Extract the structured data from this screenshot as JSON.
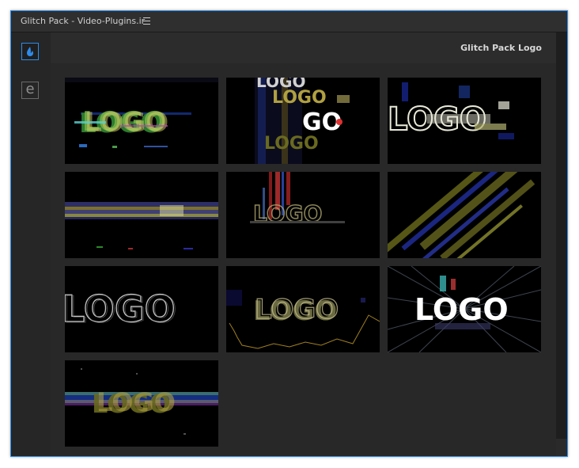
{
  "window": {
    "title": "Glitch Pack - Video-Plugins.ir",
    "accent_color": "#2d8ceb"
  },
  "sidebar": {
    "items": [
      {
        "icon": "drop-logo-icon",
        "active": true
      },
      {
        "icon": "e-letter-icon",
        "label": "e",
        "active": false
      }
    ]
  },
  "panel": {
    "title": "Glitch Pack Logo"
  },
  "thumbnails": {
    "logo_text": "LOGO",
    "go_text": "GO",
    "items": [
      {
        "style": "rgb-split"
      },
      {
        "style": "vertical-slices"
      },
      {
        "style": "outline-shatter"
      },
      {
        "style": "horizontal-blur"
      },
      {
        "style": "vertical-bars"
      },
      {
        "style": "diagonal-streaks"
      },
      {
        "style": "thin-outline"
      },
      {
        "style": "gold-noise"
      },
      {
        "style": "white-burst"
      },
      {
        "style": "band-glitch"
      }
    ]
  }
}
